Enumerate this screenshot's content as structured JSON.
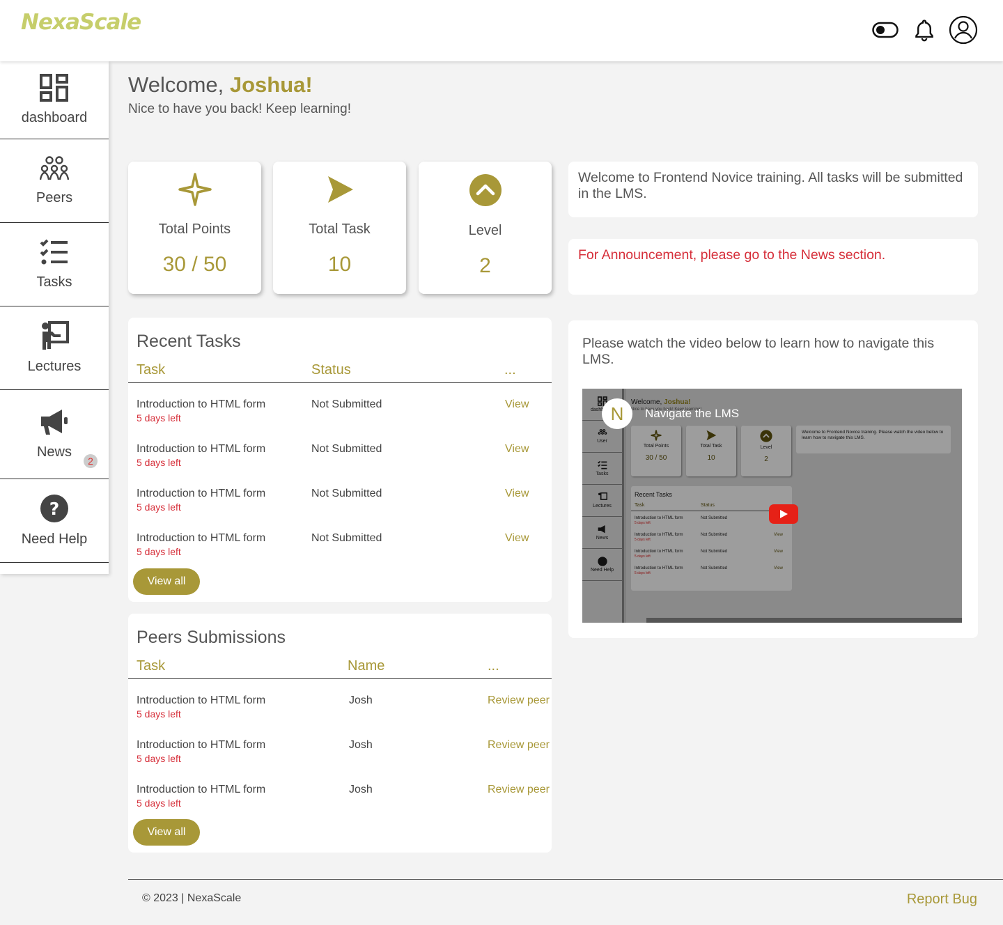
{
  "brand": {
    "logo": "NexaScale",
    "accent": "#a89838",
    "danger": "#d62f3a"
  },
  "header": {
    "icons": [
      "toggle-icon",
      "bell-icon",
      "user-avatar-icon"
    ]
  },
  "sidebar": {
    "items": [
      {
        "label": "dashboard",
        "icon": "dashboard-icon"
      },
      {
        "label": "Peers",
        "icon": "peers-icon"
      },
      {
        "label": "Tasks",
        "icon": "tasks-icon"
      },
      {
        "label": "Lectures",
        "icon": "lectures-icon"
      },
      {
        "label": "News",
        "icon": "megaphone-icon",
        "badge": "2"
      },
      {
        "label": "Need Help",
        "icon": "help-icon"
      }
    ]
  },
  "welcome": {
    "greeting": "Welcome,",
    "name": "Joshua!",
    "subtitle": "Nice to have you back! Keep learning!"
  },
  "stats": [
    {
      "title": "Total Points",
      "value": "30 / 50",
      "icon": "sparkle-icon"
    },
    {
      "title": "Total Task",
      "value": "10",
      "icon": "send-icon"
    },
    {
      "title": "Level",
      "value": "2",
      "icon": "chevron-up-icon"
    }
  ],
  "notices": {
    "training": "Welcome to Frontend Novice training. All tasks will be submitted in the LMS.",
    "announcement": "For Announcement, please go to the News section."
  },
  "recent_tasks": {
    "title": "Recent Tasks",
    "columns": [
      "Task",
      "Status",
      "..."
    ],
    "rows": [
      {
        "task": "Introduction to HTML form",
        "due": "5 days left",
        "status": "Not Submitted",
        "action": "View"
      },
      {
        "task": "Introduction to HTML form",
        "due": "5 days left",
        "status": "Not Submitted",
        "action": "View"
      },
      {
        "task": "Introduction to HTML form",
        "due": "5 days left",
        "status": "Not Submitted",
        "action": "View"
      },
      {
        "task": "Introduction to HTML form",
        "due": "5 days left",
        "status": "Not Submitted",
        "action": "View"
      }
    ],
    "button": "View all"
  },
  "peers": {
    "title": "Peers Submissions",
    "columns": [
      "Task",
      "Name",
      "..."
    ],
    "rows": [
      {
        "task": "Introduction to HTML form",
        "due": "5 days left",
        "name": "Josh",
        "action": "Review peer"
      },
      {
        "task": "Introduction to HTML form",
        "due": "5 days left",
        "name": "Josh",
        "action": "Review peer"
      },
      {
        "task": "Introduction to HTML form",
        "due": "5 days left",
        "name": "Josh",
        "action": "Review peer"
      }
    ],
    "button": "View all"
  },
  "video": {
    "text": "Please watch the video below to learn how to navigate this LMS.",
    "title": "Navigate the LMS",
    "channel_initial": "N",
    "preview": {
      "sidebar": [
        "dashboard",
        "User",
        "Tasks",
        "Lectures",
        "News",
        "Need Help"
      ],
      "greeting": "Welcome,",
      "name": "Joshua!",
      "subtitle": "Nice to have you back! Keep learning!",
      "stats": [
        {
          "title": "Total Points",
          "value": "30 / 50"
        },
        {
          "title": "Total Task",
          "value": "10"
        },
        {
          "title": "Level",
          "value": "2"
        }
      ],
      "notice": "Welcome to Frontend Novice training. Please watch the video below to learn how to navigate this LMS.",
      "panel_title": "Recent Tasks",
      "columns": [
        "Task",
        "Status"
      ],
      "rows": [
        {
          "task": "Introduction to HTML form",
          "due": "5 days left",
          "status": "Not Submitted",
          "action": ""
        },
        {
          "task": "Introduction to HTML form",
          "due": "5 days left",
          "status": "Not Submitted",
          "action": "View"
        },
        {
          "task": "Introduction to HTML form",
          "due": "5 days left",
          "status": "Not Submitted",
          "action": "View"
        },
        {
          "task": "Introduction to HTML form",
          "due": "5 days left",
          "status": "Not Submitted",
          "action": "View"
        }
      ]
    }
  },
  "footer": {
    "copyright": "© 2023 | NexaScale",
    "report": "Report Bug"
  }
}
